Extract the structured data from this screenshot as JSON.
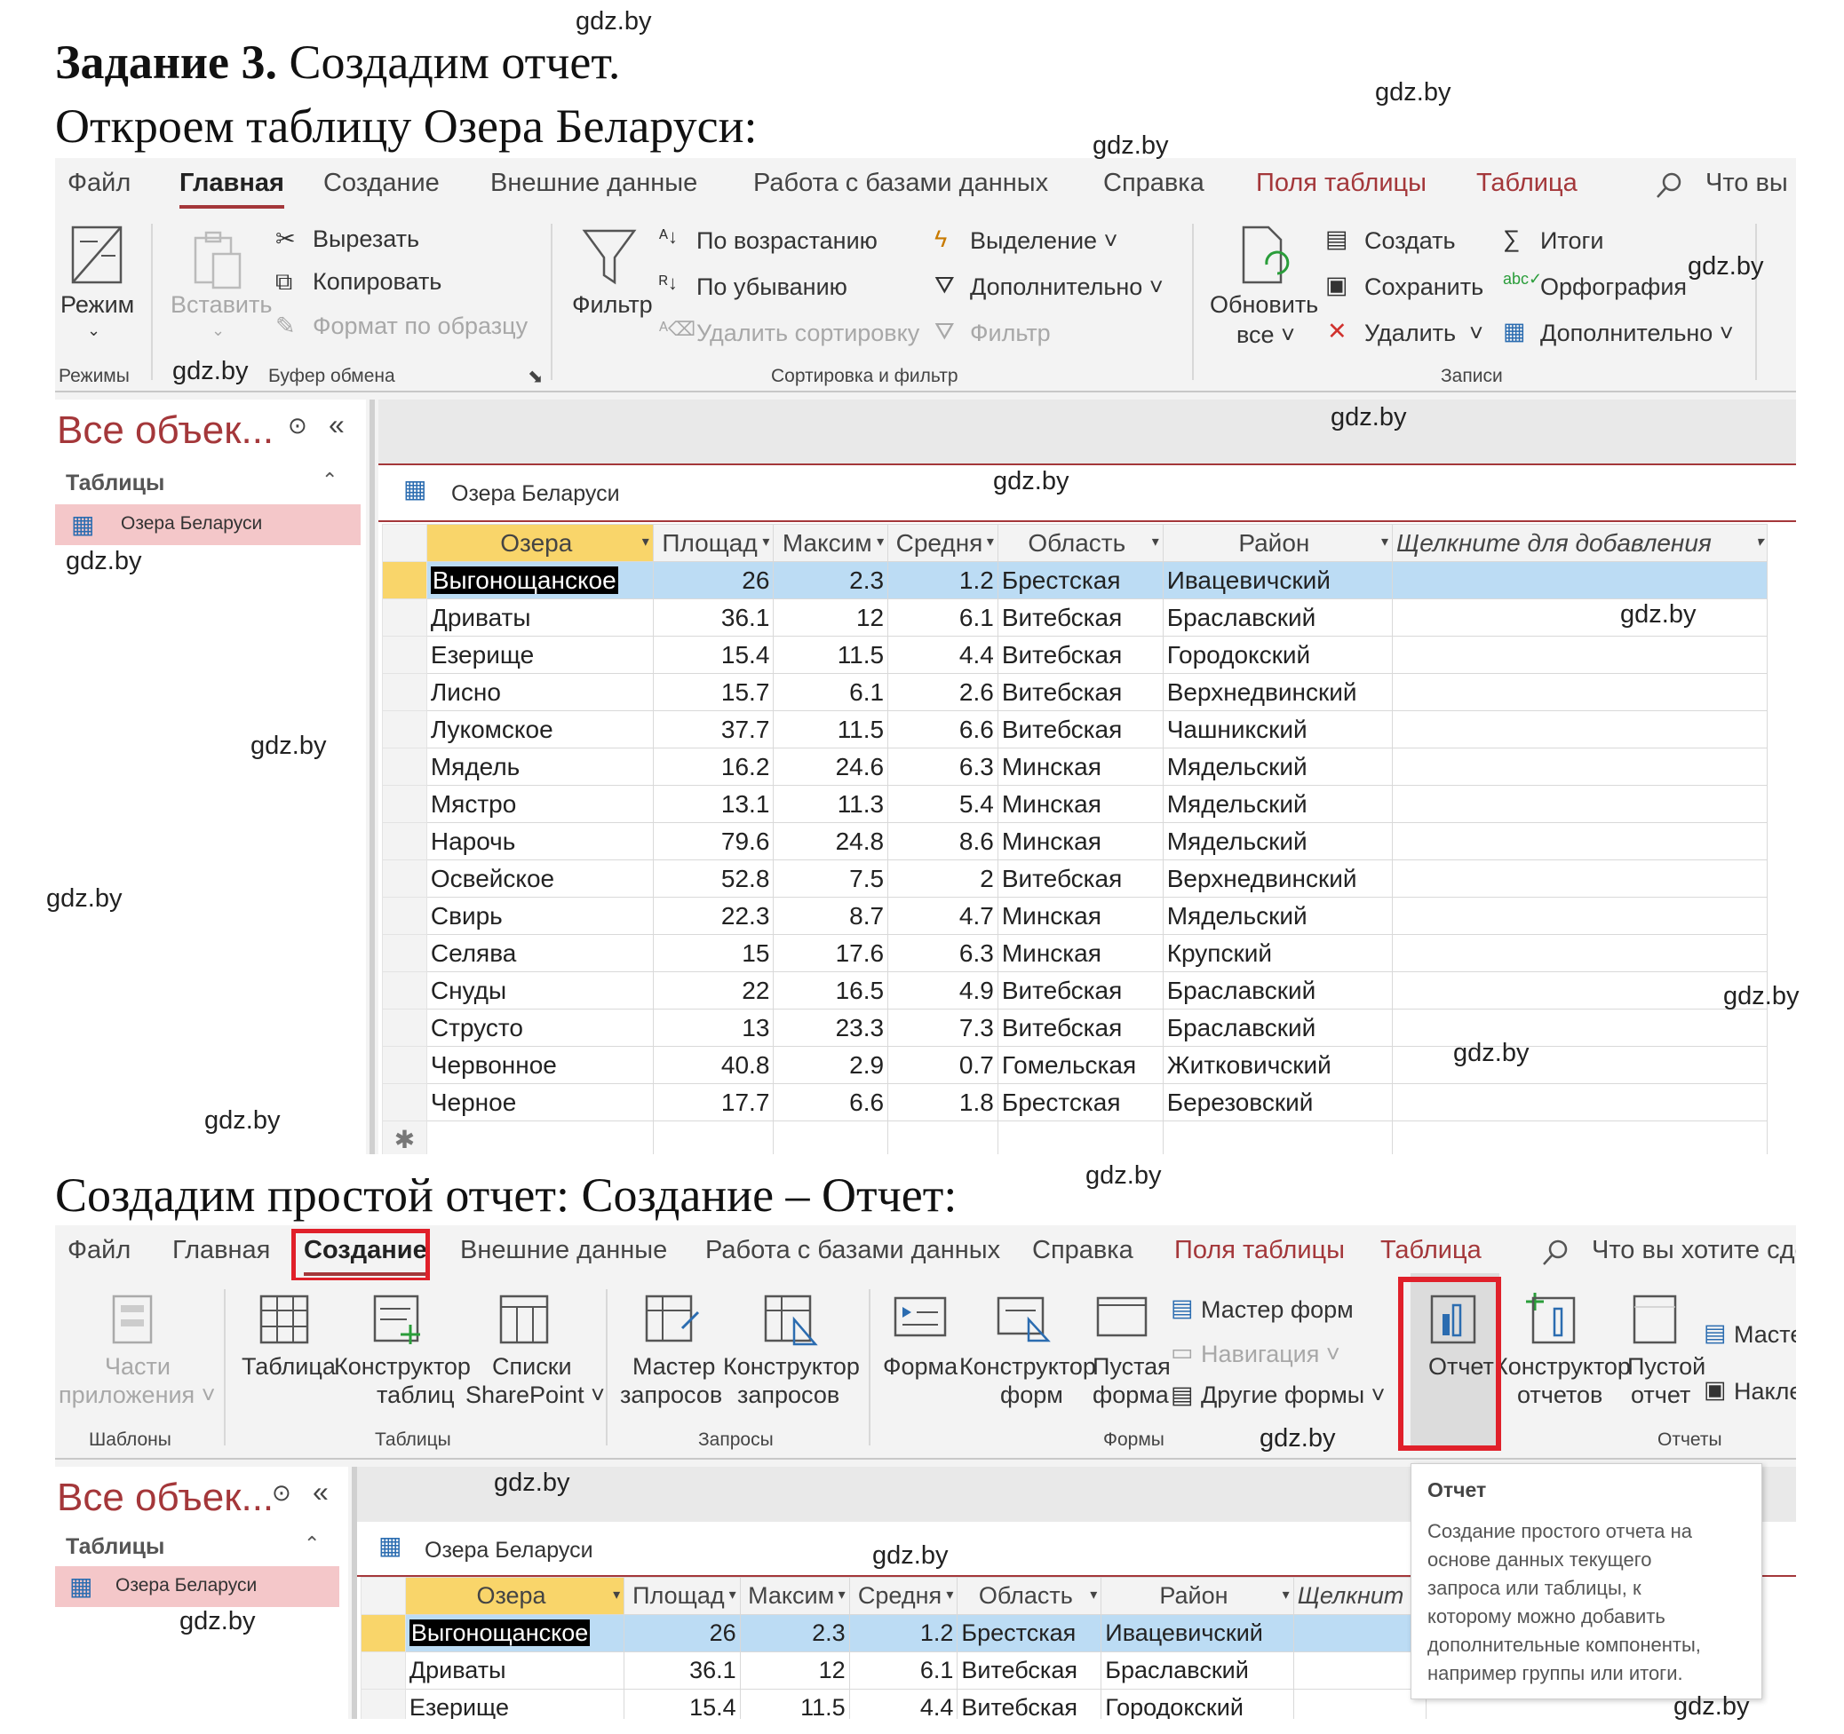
{
  "heading": {
    "bold": "Задание 3.",
    "rest": " Создадим отчет."
  },
  "subheading": "Откроем таблицу Озера Беларуси:",
  "subheading2": "Создадим простой отчет: Создание – Отчет:",
  "watermark": "gdz.by",
  "ribbon1": {
    "tabs": [
      "Файл",
      "Главная",
      "Создание",
      "Внешние данные",
      "Работа с базами данных",
      "Справка",
      "Поля таблицы",
      "Таблица",
      "Что вы"
    ],
    "mode": {
      "label": "Режим",
      "group": "Режимы"
    },
    "clipboard": {
      "paste": "Вставить",
      "cut": "Вырезать",
      "copy": "Копировать",
      "format": "Формат по образцу",
      "group": "Буфер обмена"
    },
    "sort": {
      "filter": "Фильтр",
      "asc": "По возрастанию",
      "desc": "По убыванию",
      "remove": "Удалить сортировку",
      "selection": "Выделение",
      "advanced": "Дополнительно",
      "toggle": "Фильтр",
      "group": "Сортировка и фильтр"
    },
    "records": {
      "refresh1": "Обновить",
      "refresh2": "все",
      "new": "Создать",
      "save": "Сохранить",
      "delete": "Удалить",
      "totals": "Итоги",
      "spelling": "Орфография",
      "more": "Дополнительно",
      "group": "Записи"
    }
  },
  "nav": {
    "title": "Все объек...",
    "section": "Таблицы",
    "item": "Озера Беларуси"
  },
  "doc_tab": "Озера Беларуси",
  "table": {
    "headers": [
      "Озера",
      "Площад",
      "Максим",
      "Средня",
      "Область",
      "Район",
      "Щелкните для добавления"
    ],
    "rows": [
      [
        "Выгонощанское",
        "26",
        "2.3",
        "1.2",
        "Брестская",
        "Ивацевичский"
      ],
      [
        "Дриваты",
        "36.1",
        "12",
        "6.1",
        "Витебская",
        "Браславский"
      ],
      [
        "Езерище",
        "15.4",
        "11.5",
        "4.4",
        "Витебская",
        "Городокский"
      ],
      [
        "Лисно",
        "15.7",
        "6.1",
        "2.6",
        "Витебская",
        "Верхнедвинский"
      ],
      [
        "Лукомское",
        "37.7",
        "11.5",
        "6.6",
        "Витебская",
        "Чашникский"
      ],
      [
        "Мядель",
        "16.2",
        "24.6",
        "6.3",
        "Минская",
        "Мядельский"
      ],
      [
        "Мястро",
        "13.1",
        "11.3",
        "5.4",
        "Минская",
        "Мядельский"
      ],
      [
        "Нарочь",
        "79.6",
        "24.8",
        "8.6",
        "Минская",
        "Мядельский"
      ],
      [
        "Освейское",
        "52.8",
        "7.5",
        "2",
        "Витебская",
        "Верхнедвинский"
      ],
      [
        "Свирь",
        "22.3",
        "8.7",
        "4.7",
        "Минская",
        "Мядельский"
      ],
      [
        "Селява",
        "15",
        "17.6",
        "6.3",
        "Минская",
        "Крупский"
      ],
      [
        "Снуды",
        "22",
        "16.5",
        "4.9",
        "Витебская",
        "Браславский"
      ],
      [
        "Струсто",
        "13",
        "23.3",
        "7.3",
        "Витебская",
        "Браславский"
      ],
      [
        "Червонное",
        "40.8",
        "2.9",
        "0.7",
        "Гомельская",
        "Житковичский"
      ],
      [
        "Черное",
        "17.7",
        "6.6",
        "1.8",
        "Брестская",
        "Березовский"
      ]
    ],
    "new_row": "✱"
  },
  "ribbon2": {
    "tabs": [
      "Файл",
      "Главная",
      "Создание",
      "Внешние данные",
      "Работа с базами данных",
      "Справка",
      "Поля таблицы",
      "Таблица",
      "Что вы хотите сде..."
    ],
    "templates": {
      "l1": "Части",
      "l2": "приложения",
      "group": "Шаблоны"
    },
    "tables": {
      "table": "Таблица",
      "designer1": "Конструктор",
      "designer2": "таблиц",
      "lists1": "Списки",
      "lists2": "SharePoint",
      "group": "Таблицы"
    },
    "queries": {
      "wizard1": "Мастер",
      "wizard2": "запросов",
      "designer1": "Конструктор",
      "designer2": "запросов",
      "group": "Запросы"
    },
    "forms": {
      "form": "Форма",
      "designer1": "Конструктор",
      "designer2": "форм",
      "blank1": "Пустая",
      "blank2": "форма",
      "wizard": "Мастер форм",
      "nav": "Навигация",
      "other": "Другие формы",
      "group": "Формы"
    },
    "reports": {
      "report": "Отчет",
      "designer1": "Конструктор",
      "designer2": "отчетов",
      "blank1": "Пустой",
      "blank2": "отчет",
      "wizard": "Масте",
      "labels": "Накле",
      "group": "Отчеты"
    }
  },
  "table2": {
    "headers": [
      "Озера",
      "Площад",
      "Максим",
      "Средня",
      "Область",
      "Район",
      "Щелкнит"
    ],
    "rows": [
      [
        "Выгонощанское",
        "26",
        "2.3",
        "1.2",
        "Брестская",
        "Ивацевичский"
      ],
      [
        "Дриваты",
        "36.1",
        "12",
        "6.1",
        "Витебская",
        "Браславский"
      ],
      [
        "Езерище",
        "15.4",
        "11.5",
        "4.4",
        "Витебская",
        "Городокский"
      ]
    ]
  },
  "tooltip": {
    "title": "Отчет",
    "lines": [
      "Создание простого отчета на",
      "основе данных текущего",
      "запроса или таблицы, к",
      "которому можно добавить",
      "дополнительные компоненты,",
      "например группы или итоги."
    ]
  },
  "colors": {
    "accent": "#a4373a",
    "highlight_box": "#e0202a",
    "row_select": "#bcdcf4",
    "header_active": "#f9d56a",
    "nav_item": "#f4c7c9"
  }
}
